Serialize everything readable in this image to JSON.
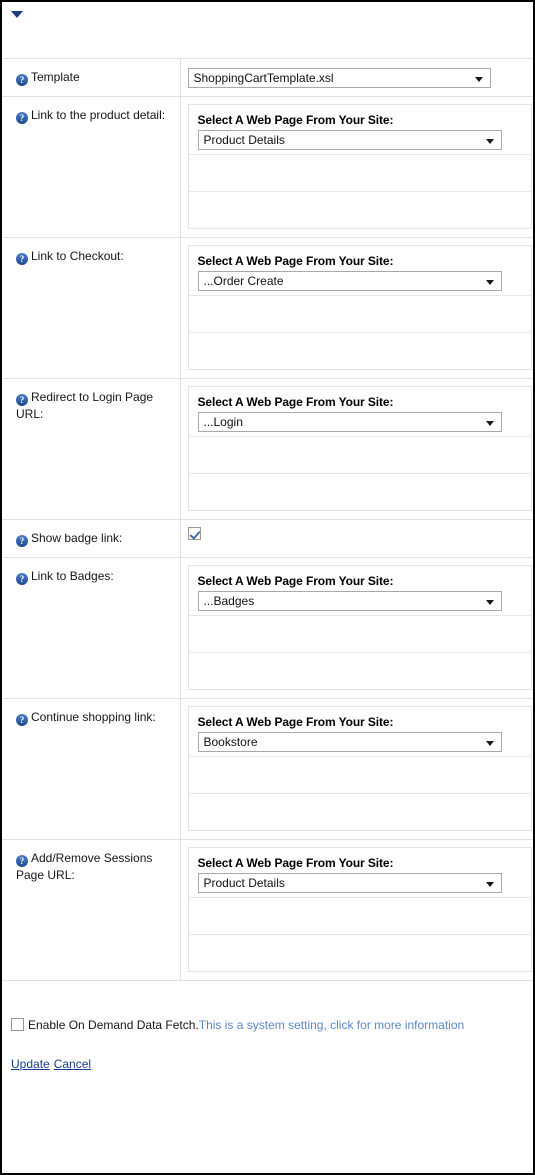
{
  "header": {
    "collapse_icon": "triangle-down-icon"
  },
  "picker_title": "Select A Web Page From Your Site:",
  "help_icon_glyph": "?",
  "rows": [
    {
      "label": "Template",
      "type": "simple-select",
      "value": "ShoppingCartTemplate.xsl"
    },
    {
      "label": "Link to the product detail:",
      "type": "page-picker",
      "value": "Product Details"
    },
    {
      "label": "Link to Checkout:",
      "type": "page-picker",
      "value": "...Order Create"
    },
    {
      "label": "Redirect to Login Page URL:",
      "type": "page-picker",
      "value": "...Login"
    },
    {
      "label": "Show badge link:",
      "type": "checkbox",
      "checked": true
    },
    {
      "label": "Link to Badges:",
      "type": "page-picker",
      "value": "...Badges"
    },
    {
      "label": "Continue shopping link:",
      "type": "page-picker",
      "value": "Bookstore"
    },
    {
      "label": "Add/Remove Sessions Page URL:",
      "type": "page-picker",
      "value": "Product Details"
    }
  ],
  "footer": {
    "on_demand_checked": false,
    "on_demand_label": "Enable On Demand Data Fetch.",
    "system_setting_link": "This is a system setting, click for more information",
    "update_label": "Update",
    "cancel_label": "Cancel"
  },
  "colors": {
    "help_icon": "#2a5caa",
    "link": "#1b3f8f",
    "system_link": "#5b8ac9",
    "border": "#e2e2e2",
    "triangle": "#1f3d82"
  }
}
